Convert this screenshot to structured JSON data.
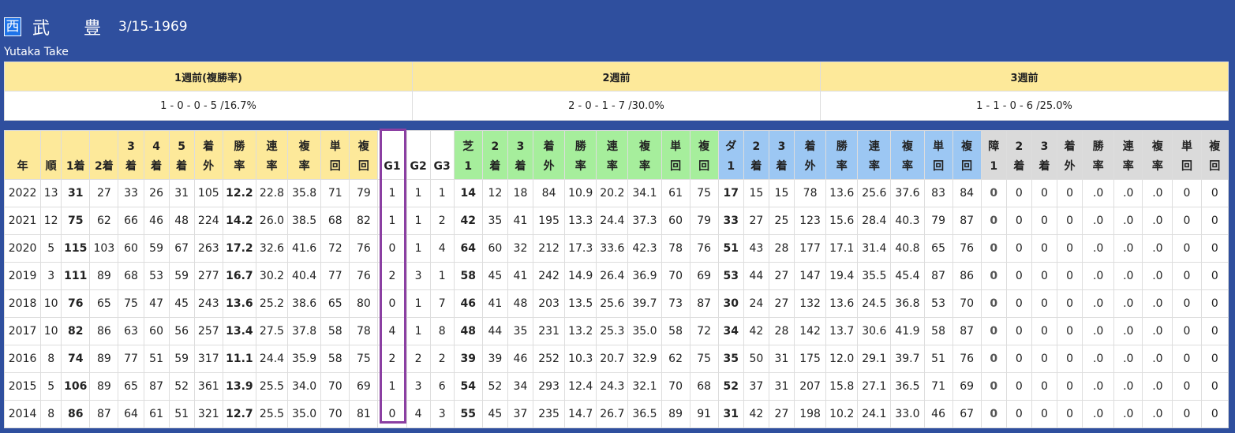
{
  "header": {
    "region_badge": "西",
    "name_jp": "武 豊",
    "birth_date": "3/15-1969",
    "name_en": "Yutaka Take"
  },
  "weekly": {
    "headers": [
      "1週前(複勝率)",
      "2週前",
      "3週前"
    ],
    "values": [
      "1 - 0 - 0 - 5 /16.7%",
      "2 - 0 - 1 - 7 /30.0%",
      "1 - 1 - 0 - 6 /25.0%"
    ]
  },
  "stats": {
    "columns": [
      {
        "label": "年",
        "group": "base"
      },
      {
        "label": "順",
        "group": "base"
      },
      {
        "label": "1着",
        "group": "base"
      },
      {
        "label": "2着",
        "group": "base"
      },
      {
        "label": "3\n着",
        "group": "base"
      },
      {
        "label": "4\n着",
        "group": "base"
      },
      {
        "label": "5\n着",
        "group": "base"
      },
      {
        "label": "着\n外",
        "group": "base"
      },
      {
        "label": "勝\n率",
        "group": "base"
      },
      {
        "label": "連\n率",
        "group": "base"
      },
      {
        "label": "複\n率",
        "group": "base"
      },
      {
        "label": "単\n回",
        "group": "base"
      },
      {
        "label": "複\n回",
        "group": "base"
      },
      {
        "label": "G1",
        "group": "g"
      },
      {
        "label": "G2",
        "group": "g"
      },
      {
        "label": "G3",
        "group": "g"
      },
      {
        "label": "芝\n1",
        "group": "turf"
      },
      {
        "label": "2\n着",
        "group": "turf"
      },
      {
        "label": "3\n着",
        "group": "turf"
      },
      {
        "label": "着\n外",
        "group": "turf"
      },
      {
        "label": "勝\n率",
        "group": "turf"
      },
      {
        "label": "連\n率",
        "group": "turf"
      },
      {
        "label": "複\n率",
        "group": "turf"
      },
      {
        "label": "単\n回",
        "group": "turf"
      },
      {
        "label": "複\n回",
        "group": "turf"
      },
      {
        "label": "ダ\n1",
        "group": "dirt"
      },
      {
        "label": "2\n着",
        "group": "dirt"
      },
      {
        "label": "3\n着",
        "group": "dirt"
      },
      {
        "label": "着\n外",
        "group": "dirt"
      },
      {
        "label": "勝\n率",
        "group": "dirt"
      },
      {
        "label": "連\n率",
        "group": "dirt"
      },
      {
        "label": "複\n率",
        "group": "dirt"
      },
      {
        "label": "単\n回",
        "group": "dirt"
      },
      {
        "label": "複\n回",
        "group": "dirt"
      },
      {
        "label": "障\n1",
        "group": "jump"
      },
      {
        "label": "2\n着",
        "group": "jump"
      },
      {
        "label": "3\n着",
        "group": "jump"
      },
      {
        "label": "着\n外",
        "group": "jump"
      },
      {
        "label": "勝\n率",
        "group": "jump"
      },
      {
        "label": "連\n率",
        "group": "jump"
      },
      {
        "label": "複\n率",
        "group": "jump"
      },
      {
        "label": "単\n回",
        "group": "jump"
      },
      {
        "label": "複\n回",
        "group": "jump"
      }
    ],
    "bold_columns": [
      2,
      8,
      16,
      25,
      34
    ],
    "rows": [
      [
        "2022",
        "13",
        "31",
        "27",
        "33",
        "26",
        "31",
        "105",
        "12.2",
        "22.8",
        "35.8",
        "71",
        "79",
        "1",
        "1",
        "1",
        "14",
        "12",
        "18",
        "84",
        "10.9",
        "20.2",
        "34.1",
        "61",
        "75",
        "17",
        "15",
        "15",
        "78",
        "13.6",
        "25.6",
        "37.6",
        "83",
        "84",
        "0",
        "0",
        "0",
        "0",
        ".0",
        ".0",
        ".0",
        "0",
        "0"
      ],
      [
        "2021",
        "12",
        "75",
        "62",
        "66",
        "46",
        "48",
        "224",
        "14.2",
        "26.0",
        "38.5",
        "68",
        "82",
        "1",
        "1",
        "2",
        "42",
        "35",
        "41",
        "195",
        "13.3",
        "24.4",
        "37.3",
        "60",
        "79",
        "33",
        "27",
        "25",
        "123",
        "15.6",
        "28.4",
        "40.3",
        "79",
        "87",
        "0",
        "0",
        "0",
        "0",
        ".0",
        ".0",
        ".0",
        "0",
        "0"
      ],
      [
        "2020",
        "5",
        "115",
        "103",
        "60",
        "59",
        "67",
        "263",
        "17.2",
        "32.6",
        "41.6",
        "72",
        "76",
        "0",
        "1",
        "4",
        "64",
        "60",
        "32",
        "212",
        "17.3",
        "33.6",
        "42.3",
        "78",
        "76",
        "51",
        "43",
        "28",
        "177",
        "17.1",
        "31.4",
        "40.8",
        "65",
        "76",
        "0",
        "0",
        "0",
        "0",
        ".0",
        ".0",
        ".0",
        "0",
        "0"
      ],
      [
        "2019",
        "3",
        "111",
        "89",
        "68",
        "53",
        "59",
        "277",
        "16.7",
        "30.2",
        "40.4",
        "77",
        "76",
        "2",
        "3",
        "1",
        "58",
        "45",
        "41",
        "242",
        "14.9",
        "26.4",
        "36.9",
        "70",
        "69",
        "53",
        "44",
        "27",
        "147",
        "19.4",
        "35.5",
        "45.4",
        "87",
        "86",
        "0",
        "0",
        "0",
        "0",
        ".0",
        ".0",
        ".0",
        "0",
        "0"
      ],
      [
        "2018",
        "10",
        "76",
        "65",
        "75",
        "47",
        "45",
        "243",
        "13.6",
        "25.2",
        "38.6",
        "65",
        "80",
        "0",
        "1",
        "7",
        "46",
        "41",
        "48",
        "203",
        "13.5",
        "25.6",
        "39.7",
        "73",
        "87",
        "30",
        "24",
        "27",
        "132",
        "13.6",
        "24.5",
        "36.8",
        "53",
        "70",
        "0",
        "0",
        "0",
        "0",
        ".0",
        ".0",
        ".0",
        "0",
        "0"
      ],
      [
        "2017",
        "10",
        "82",
        "86",
        "63",
        "60",
        "56",
        "257",
        "13.4",
        "27.5",
        "37.8",
        "58",
        "78",
        "4",
        "1",
        "8",
        "48",
        "44",
        "35",
        "231",
        "13.2",
        "25.3",
        "35.0",
        "58",
        "72",
        "34",
        "42",
        "28",
        "142",
        "13.7",
        "30.6",
        "41.9",
        "58",
        "87",
        "0",
        "0",
        "0",
        "0",
        ".0",
        ".0",
        ".0",
        "0",
        "0"
      ],
      [
        "2016",
        "8",
        "74",
        "89",
        "77",
        "51",
        "59",
        "317",
        "11.1",
        "24.4",
        "35.9",
        "58",
        "75",
        "2",
        "2",
        "2",
        "39",
        "39",
        "46",
        "252",
        "10.3",
        "20.7",
        "32.9",
        "62",
        "75",
        "35",
        "50",
        "31",
        "175",
        "12.0",
        "29.1",
        "39.7",
        "51",
        "76",
        "0",
        "0",
        "0",
        "0",
        ".0",
        ".0",
        ".0",
        "0",
        "0"
      ],
      [
        "2015",
        "5",
        "106",
        "89",
        "65",
        "87",
        "52",
        "361",
        "13.9",
        "25.5",
        "34.0",
        "70",
        "69",
        "1",
        "3",
        "6",
        "54",
        "52",
        "34",
        "293",
        "12.4",
        "24.3",
        "32.1",
        "70",
        "68",
        "52",
        "37",
        "31",
        "207",
        "15.8",
        "27.1",
        "36.5",
        "71",
        "69",
        "0",
        "0",
        "0",
        "0",
        ".0",
        ".0",
        ".0",
        "0",
        "0"
      ],
      [
        "2014",
        "8",
        "86",
        "87",
        "64",
        "61",
        "51",
        "321",
        "12.7",
        "25.5",
        "35.0",
        "70",
        "81",
        "0",
        "4",
        "3",
        "55",
        "45",
        "37",
        "235",
        "14.7",
        "26.7",
        "36.5",
        "89",
        "91",
        "31",
        "42",
        "27",
        "198",
        "10.2",
        "24.1",
        "33.0",
        "46",
        "67",
        "0",
        "0",
        "0",
        "0",
        ".0",
        ".0",
        ".0",
        "0",
        "0"
      ]
    ]
  }
}
